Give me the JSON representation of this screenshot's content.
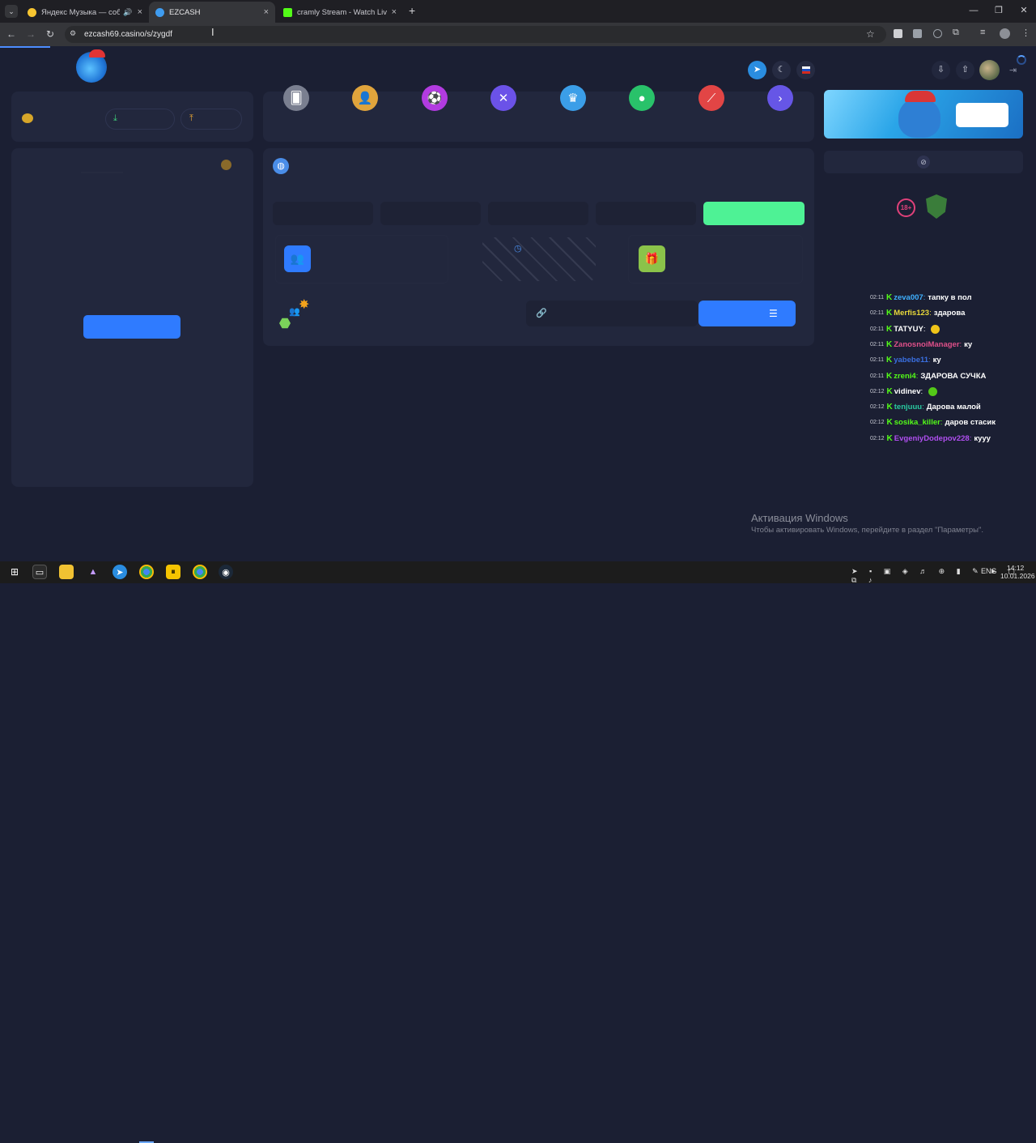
{
  "browser": {
    "tabs": [
      {
        "title": "Яндекс Музыка — собирае",
        "active": false
      },
      {
        "title": "EZCASH",
        "active": true
      },
      {
        "title": "cramly Stream - Watch Live on",
        "active": false
      }
    ],
    "new_tab": "+",
    "url": "ezcash69.casino/s/zygdf"
  },
  "site": {
    "colors": {
      "accent_blue": "#2f7bff",
      "accent_green": "#4ef295",
      "panel": "#22273d",
      "bg": "#1b1f33"
    },
    "categories": [
      {
        "name": "cards-icon",
        "color": "#7a7f90",
        "glyph": "🂠"
      },
      {
        "name": "user-icon",
        "color": "#e0a43c",
        "glyph": "👤"
      },
      {
        "name": "ball-icon",
        "color": "#b23be0",
        "glyph": "⚽"
      },
      {
        "name": "crossed-swords-icon",
        "color": "#6b52e8",
        "glyph": "✕"
      },
      {
        "name": "crown-icon",
        "color": "#3b9ee8",
        "glyph": "♛"
      },
      {
        "name": "bomb-icon",
        "color": "#29c26a",
        "glyph": "●"
      },
      {
        "name": "rocket-icon",
        "color": "#e24545",
        "glyph": "⟋"
      },
      {
        "name": "next-icon",
        "color": "#6656e6",
        "glyph": "›"
      }
    ],
    "age_badge": "18+"
  },
  "chat": [
    {
      "time": "02:11",
      "user": "zeva007",
      "user_color": "#3fb0ff",
      "msg": "тапку в пол"
    },
    {
      "time": "02:11",
      "user": "Merfis123",
      "user_color": "#e8d83a",
      "msg": "здарова"
    },
    {
      "time": "02:11",
      "user": "TATYUY",
      "user_color": "#ffffff",
      "msg": ""
    },
    {
      "time": "02:11",
      "user": "ZanosnoiManager",
      "user_color": "#e0508a",
      "msg": "ку"
    },
    {
      "time": "02:11",
      "user": "yabebe11",
      "user_color": "#3a6fe0",
      "msg": "ку"
    },
    {
      "time": "02:11",
      "user": "zreni4",
      "user_color": "#53fc18",
      "msg": "ЗДАРОВА СУЧКА"
    },
    {
      "time": "02:12",
      "user": "vidinev",
      "user_color": "#ffffff",
      "msg": ""
    },
    {
      "time": "02:12",
      "user": "tenjuuu",
      "user_color": "#29c9a0",
      "msg": "Дарова малой"
    },
    {
      "time": "02:12",
      "user": "sosika_killer",
      "user_color": "#53fc18",
      "msg": "даров стасик"
    },
    {
      "time": "02:12",
      "user": "EvgeniyDodepov228",
      "user_color": "#b04ff0",
      "msg": "кууу"
    }
  ],
  "watermark": {
    "title": "Активация Windows",
    "subtitle": "Чтобы активировать Windows, перейдите в раздел \"Параметры\"."
  },
  "taskbar": {
    "lang": "ENG",
    "time": "14:12",
    "date": "10.01.2026"
  }
}
